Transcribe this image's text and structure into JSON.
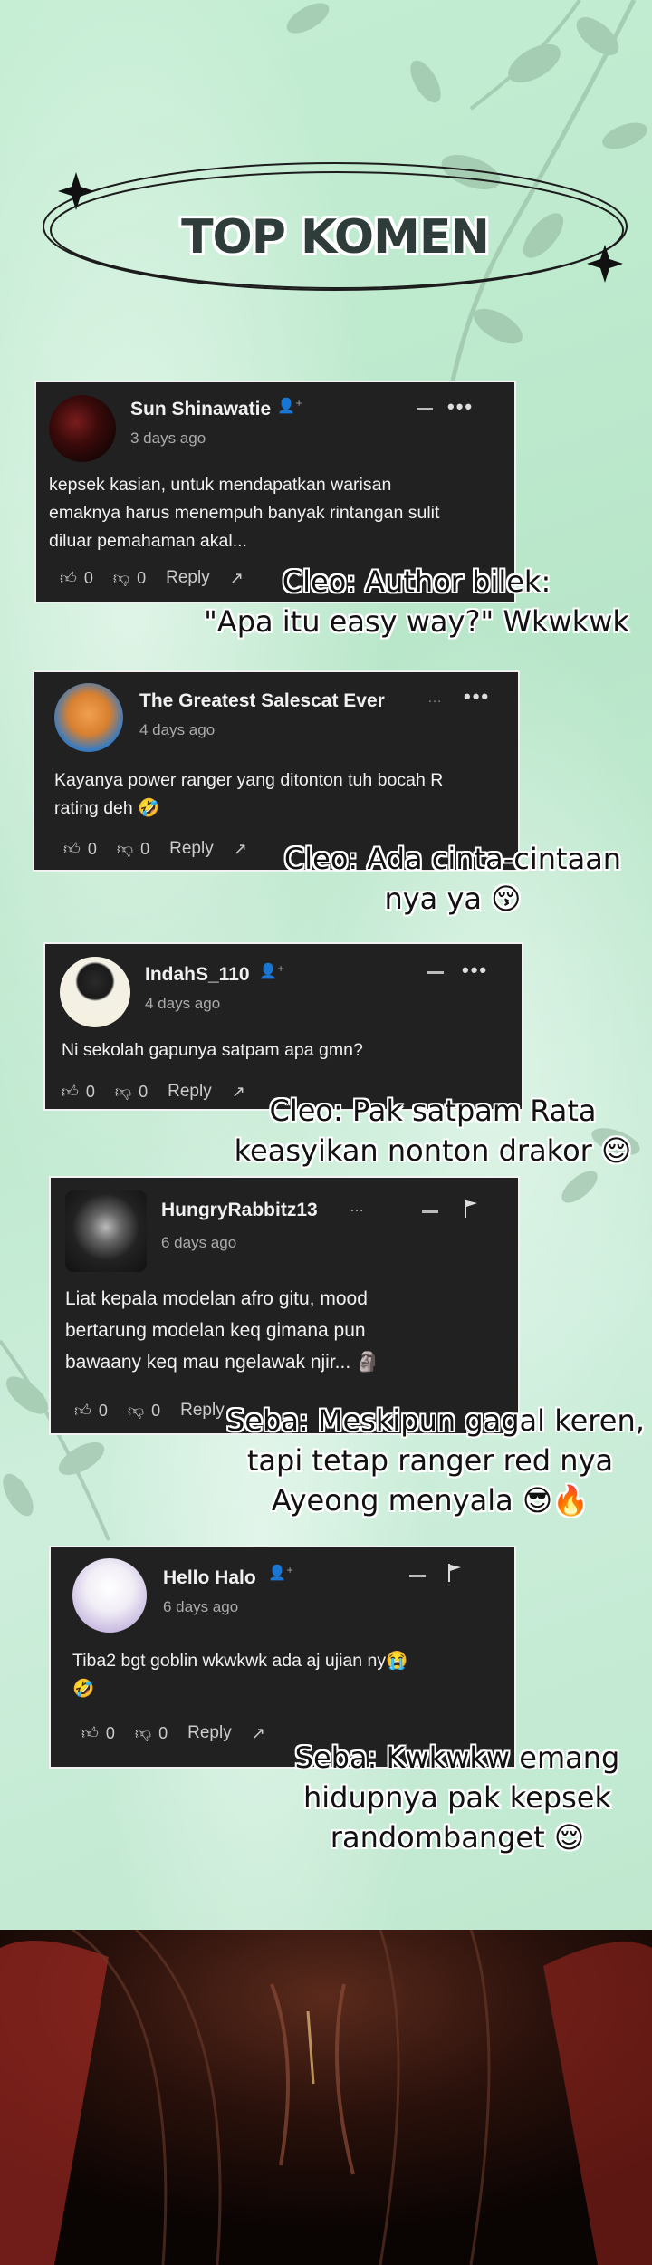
{
  "header": {
    "title": "TOP KOMEN"
  },
  "comments": [
    {
      "username": "Sun Shinawatie",
      "time": "3 days ago",
      "text": [
        "kepsek kasian, untuk mendapatkan warisan",
        "emaknya harus menempuh banyak rintangan sulit",
        "diluar pemahaman akal..."
      ],
      "likes": "0",
      "dislikes": "0",
      "reply_label": "Reply",
      "caption": [
        "Cleo: Author bilek:",
        "\"Apa itu easy way?\" Wkwkwk"
      ]
    },
    {
      "username": "The Greatest Salescat Ever",
      "time": "4 days ago",
      "text": [
        "Kayanya power ranger yang ditonton tuh bocah R",
        "rating deh 🤣"
      ],
      "likes": "0",
      "dislikes": "0",
      "reply_label": "Reply",
      "caption": [
        "Cleo: Ada cinta-cintaan",
        "nya ya 😚"
      ]
    },
    {
      "username": "IndahS_110",
      "time": "4 days ago",
      "text": [
        "Ni sekolah gapunya satpam apa gmn?"
      ],
      "likes": "0",
      "dislikes": "0",
      "reply_label": "Reply",
      "caption": [
        "Cleo: Pak satpam Rata",
        "keasyikan nonton drakor 😌"
      ]
    },
    {
      "username": "HungryRabbitz13",
      "time": "6 days ago",
      "text": [
        "Liat kepala modelan afro gitu, mood",
        "bertarung modelan keq gimana pun",
        "bawaany keq mau ngelawak njir... 🗿"
      ],
      "likes": "0",
      "dislikes": "0",
      "reply_label": "Reply",
      "caption": [
        "Seba: Meskipun gagal keren,",
        "tapi tetap ranger red nya",
        "Ayeong menyala 😎🔥"
      ]
    },
    {
      "username": "Hello Halo",
      "time": "6 days ago",
      "text": [
        "Tiba2 bgt goblin wkwkwk ada aj ujian ny😭",
        "🤣"
      ],
      "likes": "0",
      "dislikes": "0",
      "reply_label": "Reply",
      "caption": [
        "Seba: Kwkwkw emang",
        "hidupnya pak kepsek",
        "randombanget 😌"
      ]
    }
  ],
  "colors": {
    "card_bg": "#212121",
    "page_bg": "#c9ecd6",
    "title": "#2e3d3a"
  }
}
